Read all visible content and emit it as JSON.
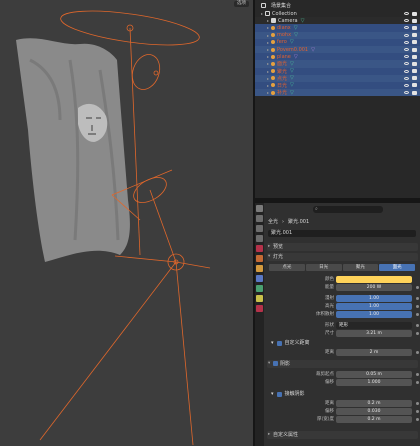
{
  "viewport": {
    "options_label": "选项"
  },
  "outliner": {
    "scene_label": "场景集合",
    "items": [
      {
        "name": "Collection",
        "kind": "collection",
        "color": "white"
      },
      {
        "name": "Camera",
        "kind": "camera",
        "color": "white"
      },
      {
        "name": "dianx",
        "kind": "light",
        "color": "orange"
      },
      {
        "name": "mohx",
        "kind": "light",
        "color": "orange"
      },
      {
        "name": "fero",
        "kind": "light",
        "color": "orange"
      },
      {
        "name": "Povem0.001",
        "kind": "light",
        "color": "orange"
      },
      {
        "name": "plane",
        "kind": "light",
        "color": "orange"
      },
      {
        "name": "面光",
        "kind": "light",
        "color": "orange"
      },
      {
        "name": "聚光",
        "kind": "light",
        "color": "orange"
      },
      {
        "name": "点光",
        "kind": "light",
        "color": "orange"
      },
      {
        "name": "日光",
        "kind": "light",
        "color": "orange"
      },
      {
        "name": "补光",
        "kind": "light",
        "color": "orange"
      }
    ]
  },
  "properties": {
    "search_placeholder": "⌕",
    "breadcrumb": [
      "全光",
      "聚光.001"
    ],
    "light_name": "聚光.001",
    "panels": {
      "preview": "预览",
      "light": "灯光",
      "custom_distance": "自定义距离",
      "shadow": "阴影",
      "contact_shadow": "接触阴影",
      "custom_props": "自定义属性"
    },
    "light_types": [
      "点光",
      "日光",
      "聚光",
      "面光"
    ],
    "light_types_short": [
      "点光",
      "日光",
      "聚光",
      "面光"
    ],
    "active_type_index": 3,
    "fields": {
      "color_label": "颜色",
      "power_label": "能量",
      "power_value": "200 W",
      "diffuse_label": "漫射",
      "diffuse_value": "1.00",
      "specular_label": "高光",
      "specular_value": "1.00",
      "volume_label": "体积散射",
      "volume_value": "1.00",
      "shape_label": "形状",
      "shape_value": "矩形",
      "size_label": "尺寸",
      "size_value": "3.21 m",
      "distance_label": "距离",
      "distance_value": "2 m",
      "clip_label": "裁剪起点",
      "clip_value": "0.05 m",
      "bias_label": "偏移",
      "bias_value": "1.000",
      "c_distance_label": "距离",
      "c_distance_value": "0.2 m",
      "c_bias_label": "偏移",
      "c_bias_value": "0.030",
      "thickness_label": "厚(宽)度",
      "thickness_value": "0.2 m"
    },
    "colors": {
      "light_color": "#ffd35a",
      "accent": "#4772b3"
    }
  }
}
